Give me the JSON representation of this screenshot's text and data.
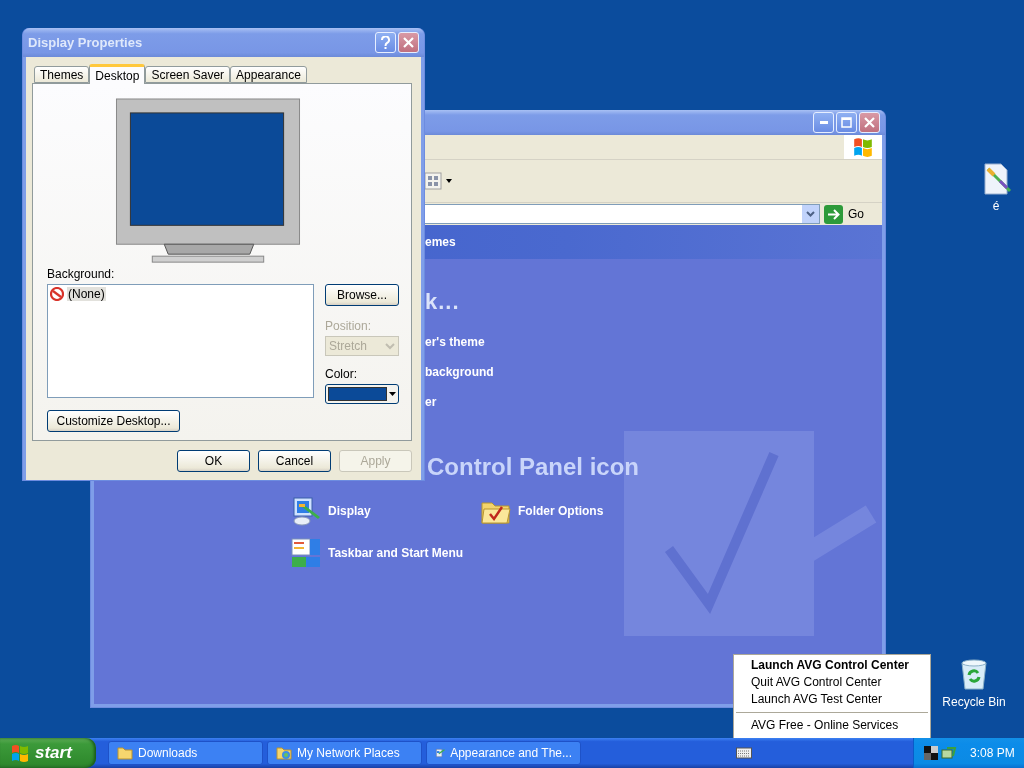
{
  "desktop_icons": [
    {
      "label": "é",
      "kind": "document"
    },
    {
      "label": "Recycle Bin",
      "kind": "recycle"
    }
  ],
  "explorer_window": {
    "go_label": "Go",
    "header": "emes",
    "heading": "k...",
    "links": [
      "er's theme",
      "background",
      "er"
    ],
    "section_title": "Control Panel icon",
    "items": [
      {
        "label": "Display",
        "kind": "display"
      },
      {
        "label": "Folder Options",
        "kind": "folder"
      },
      {
        "label": "Taskbar and Start Menu",
        "kind": "taskbar"
      }
    ]
  },
  "dialog": {
    "title": "Display Properties",
    "tabs": [
      {
        "label": "Themes",
        "selected": false
      },
      {
        "label": "Desktop",
        "selected": true
      },
      {
        "label": "Screen Saver",
        "selected": false
      },
      {
        "label": "Appearance",
        "selected": false
      }
    ],
    "background_label": "Background:",
    "backgrounds": [
      {
        "label": "(None)",
        "selected": true
      }
    ],
    "browse": "Browse...",
    "position_label": "Position:",
    "position": {
      "value": "Stretch",
      "disabled": true
    },
    "color_label": "Color:",
    "color": "#0b4a98",
    "customize": "Customize Desktop...",
    "buttons": [
      {
        "label": "OK",
        "disabled": false
      },
      {
        "label": "Cancel",
        "disabled": false
      },
      {
        "label": "Apply",
        "disabled": true
      }
    ]
  },
  "context_menu": {
    "items": [
      {
        "kind": "item",
        "label": "Launch AVG Control Center",
        "default": true
      },
      {
        "kind": "item",
        "label": "Quit AVG Control Center",
        "default": false
      },
      {
        "kind": "item",
        "label": "Launch AVG Test Center",
        "default": false
      },
      {
        "kind": "separator"
      },
      {
        "kind": "item",
        "label": "AVG Free - Online Services",
        "default": false
      }
    ]
  },
  "taskbar": {
    "start": "start",
    "tasks": [
      {
        "label": "Downloads",
        "kind": "folder"
      },
      {
        "label": "My Network Places",
        "kind": "network"
      },
      {
        "label": "Appearance and The...",
        "kind": "control"
      }
    ],
    "clock": "3:08 PM"
  }
}
